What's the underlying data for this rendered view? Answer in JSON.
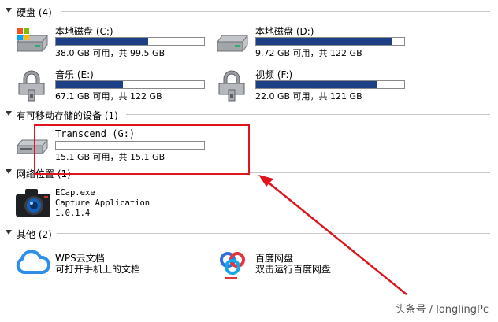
{
  "sections": {
    "hard_disks": {
      "title": "硬盘 (4)"
    },
    "removable": {
      "title": "有可移动存储的设备 (1)"
    },
    "network": {
      "title": "网络位置 (1)"
    },
    "other": {
      "title": "其他 (2)"
    }
  },
  "drives": [
    {
      "label": "本地磁盘 (C:)",
      "free": "38.0 GB 可用，共 99.5 GB",
      "used_fraction": 0.62
    },
    {
      "label": "本地磁盘 (D:)",
      "free": "9.72 GB 可用，共 122 GB",
      "used_fraction": 0.92
    },
    {
      "label": "音乐 (E:)",
      "free": "67.1 GB 可用，共 122 GB",
      "used_fraction": 0.45
    },
    {
      "label": "视频 (F:)",
      "free": "22.0 GB 可用，共 121 GB",
      "used_fraction": 0.82
    }
  ],
  "removable_drive": {
    "label": "Transcend (G:)",
    "free": "15.1 GB 可用，共 15.1 GB",
    "used_fraction": 0.0
  },
  "network_item": {
    "line1": "ECap.exe",
    "line2": "Capture Application",
    "line3": "1.0.1.4"
  },
  "other_items": [
    {
      "title": "WPS云文档",
      "subtitle": "可打开手机上的文档",
      "icon": "cloud-icon"
    },
    {
      "title": "百度网盘",
      "subtitle": "双击运行百度网盘",
      "icon": "baidu-netdisk-icon"
    }
  ],
  "colors": {
    "bar_fill": "#1c3f86",
    "annotation_red": "#e0141c",
    "wps_blue": "#2f8ee8"
  },
  "watermark": "头条号 / longlingPc"
}
